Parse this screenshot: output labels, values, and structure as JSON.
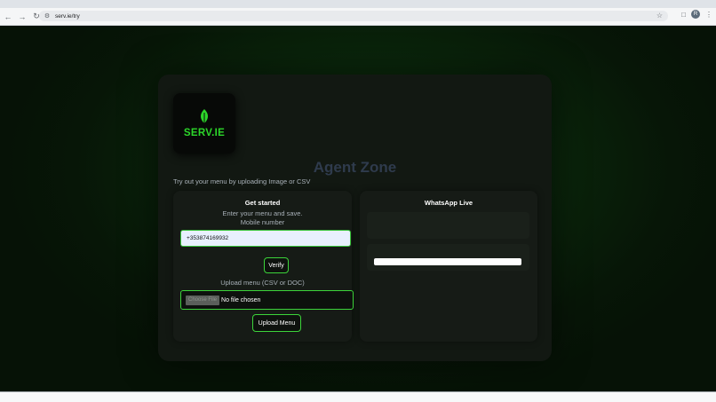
{
  "browser": {
    "url": "serv.ie/try",
    "profile_initial": "R"
  },
  "card": {
    "logo_text": "SERV.IE",
    "title": "Agent Zone",
    "subtitle": "Try out your menu by uploading Image or CSV"
  },
  "get_started": {
    "title": "Get started",
    "hint": "Enter your menu and save.",
    "mobile_label": "Mobile number",
    "phone_value": "+353874169932",
    "verify_label": "Verify",
    "upload_label": "Upload menu (CSV or DOC)",
    "choose_file_label": "Choose File",
    "no_file_label": "No file chosen",
    "upload_button_label": "Upload Menu"
  },
  "whatsapp": {
    "title": "WhatsApp Live"
  },
  "colors": {
    "accent": "#3cd43a",
    "logo_green": "#2cd62a",
    "title_color": "#2f3b4d"
  }
}
